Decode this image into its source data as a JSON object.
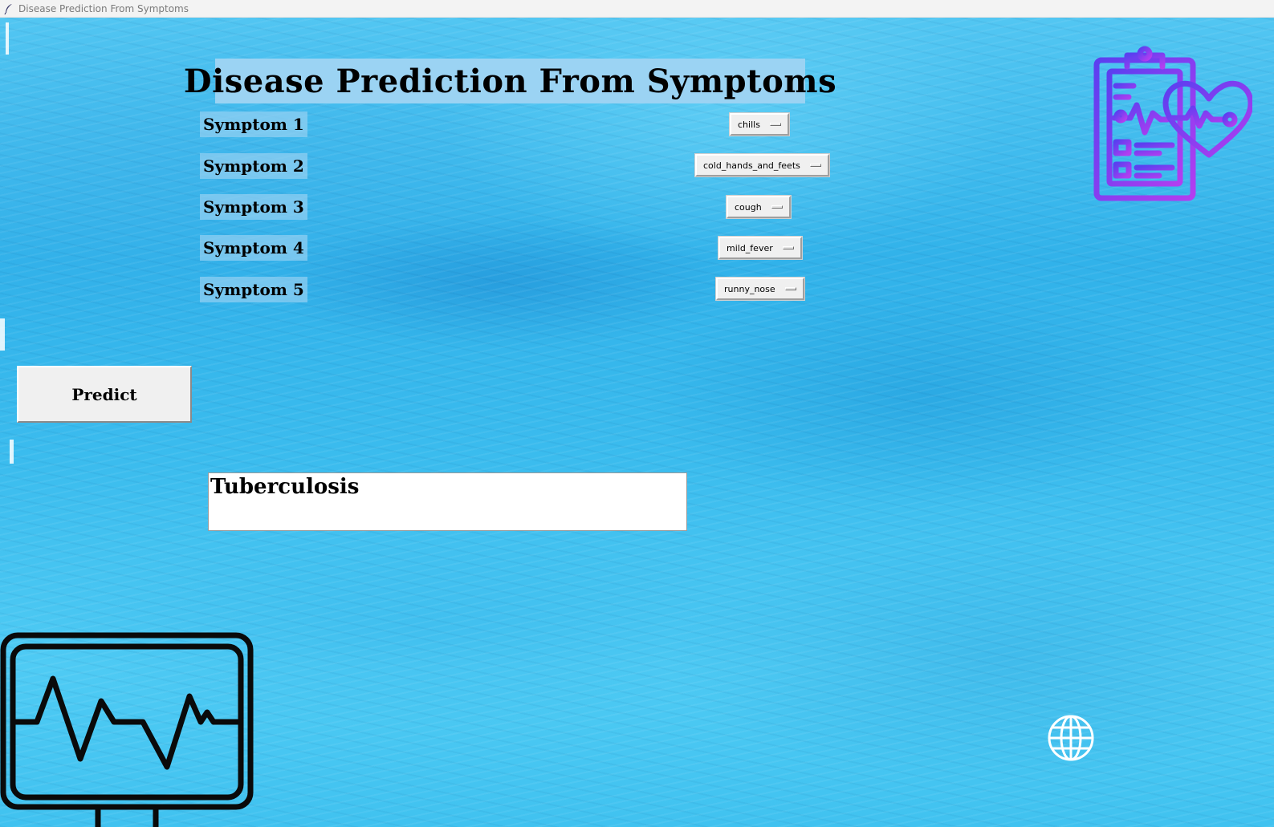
{
  "window": {
    "title": "Disease Prediction From Symptoms",
    "app_icon": "feather-icon"
  },
  "app": {
    "heading": "Disease Prediction From Symptoms"
  },
  "symptoms": [
    {
      "label": "Symptom 1",
      "selected": "chills"
    },
    {
      "label": "Symptom 2",
      "selected": "cold_hands_and_feets"
    },
    {
      "label": "Symptom 3",
      "selected": "cough"
    },
    {
      "label": "Symptom 4",
      "selected": "mild_fever"
    },
    {
      "label": "Symptom 5",
      "selected": "runny_nose"
    }
  ],
  "predict": {
    "label": "Predict"
  },
  "result": {
    "text": "Tuberculosis"
  },
  "decorations": {
    "top_right": "medical-clipboard-heart-icon",
    "bottom_left": "heart-monitor-icon",
    "bottom_right": "globe-icon"
  },
  "colors": {
    "title_bg": "#9bd3f3",
    "water": "#31b2ea",
    "clipboard_gradient_start": "#5b3ff0",
    "clipboard_gradient_end": "#b23ef0"
  }
}
